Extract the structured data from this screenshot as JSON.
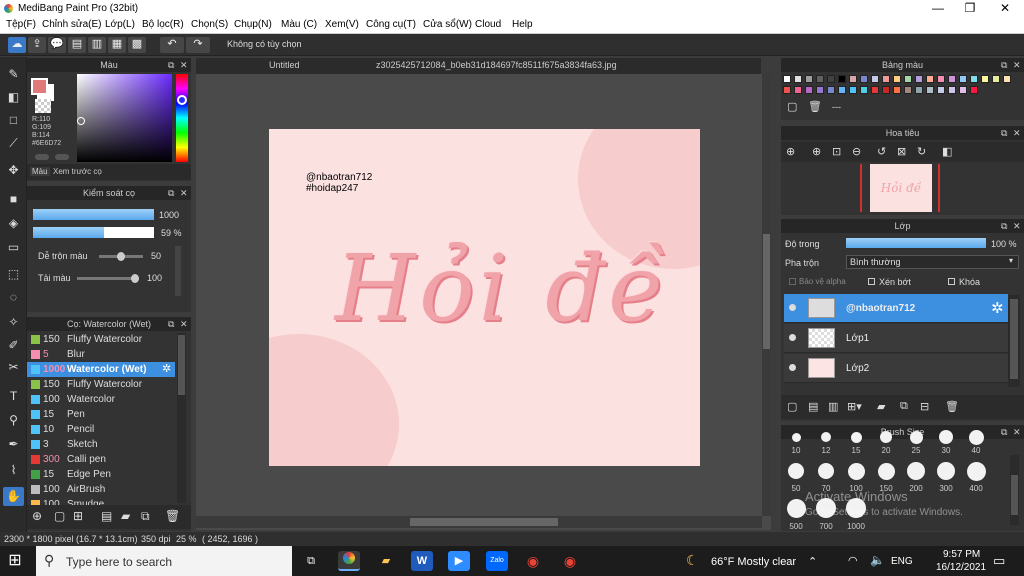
{
  "window": {
    "title": "MediBang Paint Pro (32bit)",
    "minimize": "—",
    "maximize": "❐",
    "close": "✕"
  },
  "menu": [
    "Tệp(F)",
    "Chỉnh sửa(E)",
    "Lớp(L)",
    "Bộ lọc(R)",
    "Chọn(S)",
    "Chụp(N)",
    "Màu (C)",
    "Xem(V)",
    "Công cụ(T)",
    "Cửa sổ(W)",
    "Cloud",
    "Help"
  ],
  "toolbar": {
    "status": "Không có tùy chọn"
  },
  "color_panel": {
    "title": "Màu",
    "rgb_r": "R:110",
    "rgb_g": "G:109",
    "rgb_b": "B:114",
    "hex": "#6E6D72",
    "tab_color": "Màu",
    "tab_preview": "Xem trước cọ",
    "fg": "#e07a7a"
  },
  "brush_control": {
    "title": "Kiểm soát cọ",
    "size": "1000",
    "opacity": "59 %",
    "opacity_fraction": 0.59,
    "blend_label": "Dễ trộn màu",
    "blend_value": "50",
    "blend_fraction": 0.5,
    "reload_label": "Tải màu",
    "reload_value": "100",
    "reload_fraction": 1.0
  },
  "brush_list": {
    "title": "Cọ: Watercolor (Wet)",
    "items": [
      {
        "size": "150",
        "name": "Fluffy Watercolor",
        "color": "#8bc34a"
      },
      {
        "size": "5",
        "name": "Blur",
        "color": "#f48fb1"
      },
      {
        "size": "1000",
        "name": "Watercolor (Wet)",
        "color": "#4fc3f7"
      },
      {
        "size": "150",
        "name": "Fluffy Watercolor",
        "color": "#8bc34a"
      },
      {
        "size": "100",
        "name": "Watercolor",
        "color": "#4fc3f7"
      },
      {
        "size": "15",
        "name": "Pen",
        "color": "#4fc3f7"
      },
      {
        "size": "10",
        "name": "Pencil",
        "color": "#4fc3f7"
      },
      {
        "size": "3",
        "name": "Sketch",
        "color": "#4fc3f7"
      },
      {
        "size": "300",
        "name": "Calli pen",
        "color": "#e53935"
      },
      {
        "size": "15",
        "name": "Edge Pen",
        "color": "#43a047"
      },
      {
        "size": "100",
        "name": "AirBrush",
        "color": "#bdbdbd"
      },
      {
        "size": "100",
        "name": "Smudge",
        "color": "#ffb74d"
      }
    ]
  },
  "tabs": [
    "Untitled",
    "z3025425712084_b0eb31d184697fc8511f675a3834fa63.jpg"
  ],
  "canvas": {
    "handle_line1": "@nbaotran712",
    "handle_line2": "#hoidap247",
    "art_text": "Hỏi đề"
  },
  "palette": {
    "title": "Bảng màu",
    "set_name": "---"
  },
  "navigator": {
    "title": "Hoa tiêu"
  },
  "layers": {
    "title": "Lớp",
    "opacity_label": "Độ trong",
    "opacity_value": "100 %",
    "blend_label": "Pha trộn",
    "blend_value": "Bình thường",
    "protect_alpha": "Bảo vệ alpha",
    "clip": "Xén bớt",
    "lock": "Khóa",
    "items": [
      {
        "name": "@nbaotran712",
        "selected": true
      },
      {
        "name": "Lớp1",
        "selected": false
      },
      {
        "name": "Lớp2",
        "selected": false
      }
    ]
  },
  "brush_size": {
    "title": "Brush Size",
    "row1": [
      "10",
      "12",
      "15",
      "20",
      "25",
      "30",
      "40"
    ],
    "row2": [
      "50",
      "70",
      "100",
      "150",
      "200",
      "300",
      "400"
    ],
    "row3": [
      "500",
      "700",
      "1000"
    ]
  },
  "activation": {
    "line1": "Activate Windows",
    "line2": "Go to Settings to activate Windows."
  },
  "status": {
    "size": "2300 * 1800 pixel",
    "dims": "(16.7 * 13.1cm)",
    "dpi": "350 dpi",
    "zoom": "25 %",
    "coords": "( 2452, 1696 )"
  },
  "taskbar": {
    "search": "Type here to search",
    "weather": "66°F  Mostly clear",
    "lang": "ENG",
    "time": "9:57 PM",
    "date": "16/12/2021"
  }
}
